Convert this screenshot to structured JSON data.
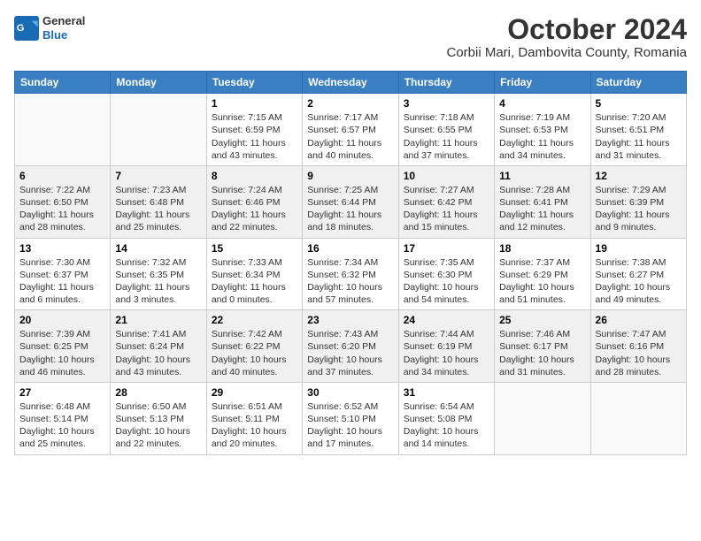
{
  "header": {
    "logo": {
      "general": "General",
      "blue": "Blue"
    },
    "title": "October 2024",
    "location": "Corbii Mari, Dambovita County, Romania"
  },
  "weekdays": [
    "Sunday",
    "Monday",
    "Tuesday",
    "Wednesday",
    "Thursday",
    "Friday",
    "Saturday"
  ],
  "weeks": [
    [
      {
        "day": "",
        "info": ""
      },
      {
        "day": "",
        "info": ""
      },
      {
        "day": "1",
        "info": "Sunrise: 7:15 AM\nSunset: 6:59 PM\nDaylight: 11 hours and 43 minutes."
      },
      {
        "day": "2",
        "info": "Sunrise: 7:17 AM\nSunset: 6:57 PM\nDaylight: 11 hours and 40 minutes."
      },
      {
        "day": "3",
        "info": "Sunrise: 7:18 AM\nSunset: 6:55 PM\nDaylight: 11 hours and 37 minutes."
      },
      {
        "day": "4",
        "info": "Sunrise: 7:19 AM\nSunset: 6:53 PM\nDaylight: 11 hours and 34 minutes."
      },
      {
        "day": "5",
        "info": "Sunrise: 7:20 AM\nSunset: 6:51 PM\nDaylight: 11 hours and 31 minutes."
      }
    ],
    [
      {
        "day": "6",
        "info": "Sunrise: 7:22 AM\nSunset: 6:50 PM\nDaylight: 11 hours and 28 minutes."
      },
      {
        "day": "7",
        "info": "Sunrise: 7:23 AM\nSunset: 6:48 PM\nDaylight: 11 hours and 25 minutes."
      },
      {
        "day": "8",
        "info": "Sunrise: 7:24 AM\nSunset: 6:46 PM\nDaylight: 11 hours and 22 minutes."
      },
      {
        "day": "9",
        "info": "Sunrise: 7:25 AM\nSunset: 6:44 PM\nDaylight: 11 hours and 18 minutes."
      },
      {
        "day": "10",
        "info": "Sunrise: 7:27 AM\nSunset: 6:42 PM\nDaylight: 11 hours and 15 minutes."
      },
      {
        "day": "11",
        "info": "Sunrise: 7:28 AM\nSunset: 6:41 PM\nDaylight: 11 hours and 12 minutes."
      },
      {
        "day": "12",
        "info": "Sunrise: 7:29 AM\nSunset: 6:39 PM\nDaylight: 11 hours and 9 minutes."
      }
    ],
    [
      {
        "day": "13",
        "info": "Sunrise: 7:30 AM\nSunset: 6:37 PM\nDaylight: 11 hours and 6 minutes."
      },
      {
        "day": "14",
        "info": "Sunrise: 7:32 AM\nSunset: 6:35 PM\nDaylight: 11 hours and 3 minutes."
      },
      {
        "day": "15",
        "info": "Sunrise: 7:33 AM\nSunset: 6:34 PM\nDaylight: 11 hours and 0 minutes."
      },
      {
        "day": "16",
        "info": "Sunrise: 7:34 AM\nSunset: 6:32 PM\nDaylight: 10 hours and 57 minutes."
      },
      {
        "day": "17",
        "info": "Sunrise: 7:35 AM\nSunset: 6:30 PM\nDaylight: 10 hours and 54 minutes."
      },
      {
        "day": "18",
        "info": "Sunrise: 7:37 AM\nSunset: 6:29 PM\nDaylight: 10 hours and 51 minutes."
      },
      {
        "day": "19",
        "info": "Sunrise: 7:38 AM\nSunset: 6:27 PM\nDaylight: 10 hours and 49 minutes."
      }
    ],
    [
      {
        "day": "20",
        "info": "Sunrise: 7:39 AM\nSunset: 6:25 PM\nDaylight: 10 hours and 46 minutes."
      },
      {
        "day": "21",
        "info": "Sunrise: 7:41 AM\nSunset: 6:24 PM\nDaylight: 10 hours and 43 minutes."
      },
      {
        "day": "22",
        "info": "Sunrise: 7:42 AM\nSunset: 6:22 PM\nDaylight: 10 hours and 40 minutes."
      },
      {
        "day": "23",
        "info": "Sunrise: 7:43 AM\nSunset: 6:20 PM\nDaylight: 10 hours and 37 minutes."
      },
      {
        "day": "24",
        "info": "Sunrise: 7:44 AM\nSunset: 6:19 PM\nDaylight: 10 hours and 34 minutes."
      },
      {
        "day": "25",
        "info": "Sunrise: 7:46 AM\nSunset: 6:17 PM\nDaylight: 10 hours and 31 minutes."
      },
      {
        "day": "26",
        "info": "Sunrise: 7:47 AM\nSunset: 6:16 PM\nDaylight: 10 hours and 28 minutes."
      }
    ],
    [
      {
        "day": "27",
        "info": "Sunrise: 6:48 AM\nSunset: 5:14 PM\nDaylight: 10 hours and 25 minutes."
      },
      {
        "day": "28",
        "info": "Sunrise: 6:50 AM\nSunset: 5:13 PM\nDaylight: 10 hours and 22 minutes."
      },
      {
        "day": "29",
        "info": "Sunrise: 6:51 AM\nSunset: 5:11 PM\nDaylight: 10 hours and 20 minutes."
      },
      {
        "day": "30",
        "info": "Sunrise: 6:52 AM\nSunset: 5:10 PM\nDaylight: 10 hours and 17 minutes."
      },
      {
        "day": "31",
        "info": "Sunrise: 6:54 AM\nSunset: 5:08 PM\nDaylight: 10 hours and 14 minutes."
      },
      {
        "day": "",
        "info": ""
      },
      {
        "day": "",
        "info": ""
      }
    ]
  ]
}
